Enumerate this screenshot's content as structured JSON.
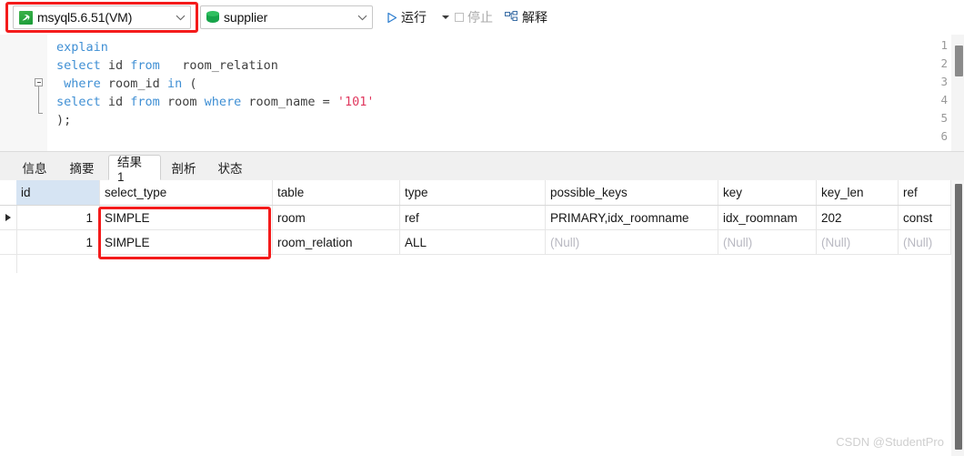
{
  "toolbar": {
    "connection": {
      "icon": "mysql-dolphin-icon",
      "value": "msyql5.6.51(VM)"
    },
    "database": {
      "icon": "database-cylinder-icon",
      "value": "supplier"
    },
    "run_label": "运行",
    "run_icon": "play-triangle-icon",
    "run_more_icon": "caret-down-icon",
    "stop_label": "停止",
    "stop_icon": "stop-square-icon",
    "stop_disabled": true,
    "explain_label": "解释",
    "explain_icon": "explain-tree-icon",
    "accent_blue": "#2f7fd0",
    "disabled_gray": "#aaaaaa"
  },
  "editor": {
    "line_numbers": [
      "1",
      "2",
      "3",
      "4",
      "5",
      "6"
    ],
    "lines": [
      {
        "n": "1",
        "tokens": [
          {
            "t": "explain",
            "c": "kw"
          }
        ]
      },
      {
        "n": "2",
        "tokens": [
          {
            "t": "select",
            "c": "kw"
          },
          {
            "t": " id ",
            "c": "id"
          },
          {
            "t": "from",
            "c": "kw"
          },
          {
            "t": "   room_relation",
            "c": "id"
          }
        ]
      },
      {
        "n": "3",
        "tokens": [
          {
            "t": " ",
            "c": "id"
          },
          {
            "t": "where",
            "c": "kw"
          },
          {
            "t": " room_id ",
            "c": "id"
          },
          {
            "t": "in",
            "c": "kw"
          },
          {
            "t": " (",
            "c": "pn"
          }
        ]
      },
      {
        "n": "4",
        "tokens": [
          {
            "t": "select",
            "c": "kw"
          },
          {
            "t": " id ",
            "c": "id"
          },
          {
            "t": "from",
            "c": "kw"
          },
          {
            "t": " room ",
            "c": "id"
          },
          {
            "t": "where",
            "c": "kw"
          },
          {
            "t": " room_name = ",
            "c": "id"
          },
          {
            "t": "'101'",
            "c": "str"
          }
        ]
      },
      {
        "n": "5",
        "tokens": [
          {
            "t": ");",
            "c": "pn"
          }
        ]
      },
      {
        "n": "6",
        "tokens": []
      }
    ],
    "keyword_color": "#3f8fd4",
    "string_color": "#e0385e",
    "fold_marker": "collapse-box-icon"
  },
  "tabs": [
    {
      "label": "信息",
      "active": false
    },
    {
      "label": "摘要",
      "active": false
    },
    {
      "label": "结果 1",
      "active": true
    },
    {
      "label": "剖析",
      "active": false
    },
    {
      "label": "状态",
      "active": false
    }
  ],
  "result_grid": {
    "columns": [
      "id",
      "select_type",
      "table",
      "type",
      "possible_keys",
      "key",
      "key_len",
      "ref"
    ],
    "selected_column": "id",
    "rows": [
      {
        "marker": true,
        "cells": [
          "1",
          "SIMPLE",
          "room",
          "ref",
          "PRIMARY,idx_roomname",
          "idx_roomnam",
          "202",
          "const"
        ],
        "nulls": [
          false,
          false,
          false,
          false,
          false,
          false,
          false,
          false
        ]
      },
      {
        "marker": false,
        "cells": [
          "1",
          "SIMPLE",
          "room_relation",
          "ALL",
          "(Null)",
          "(Null)",
          "(Null)",
          "(Null)"
        ],
        "nulls": [
          false,
          false,
          false,
          false,
          true,
          true,
          true,
          true
        ]
      }
    ],
    "null_text": "(Null)"
  },
  "annotations": [
    {
      "name": "connection-highlight",
      "color": "#f41b1b"
    },
    {
      "name": "select-type-highlight",
      "color": "#f41b1b"
    }
  ],
  "watermark": {
    "text": "CSDN @StudentPro"
  }
}
